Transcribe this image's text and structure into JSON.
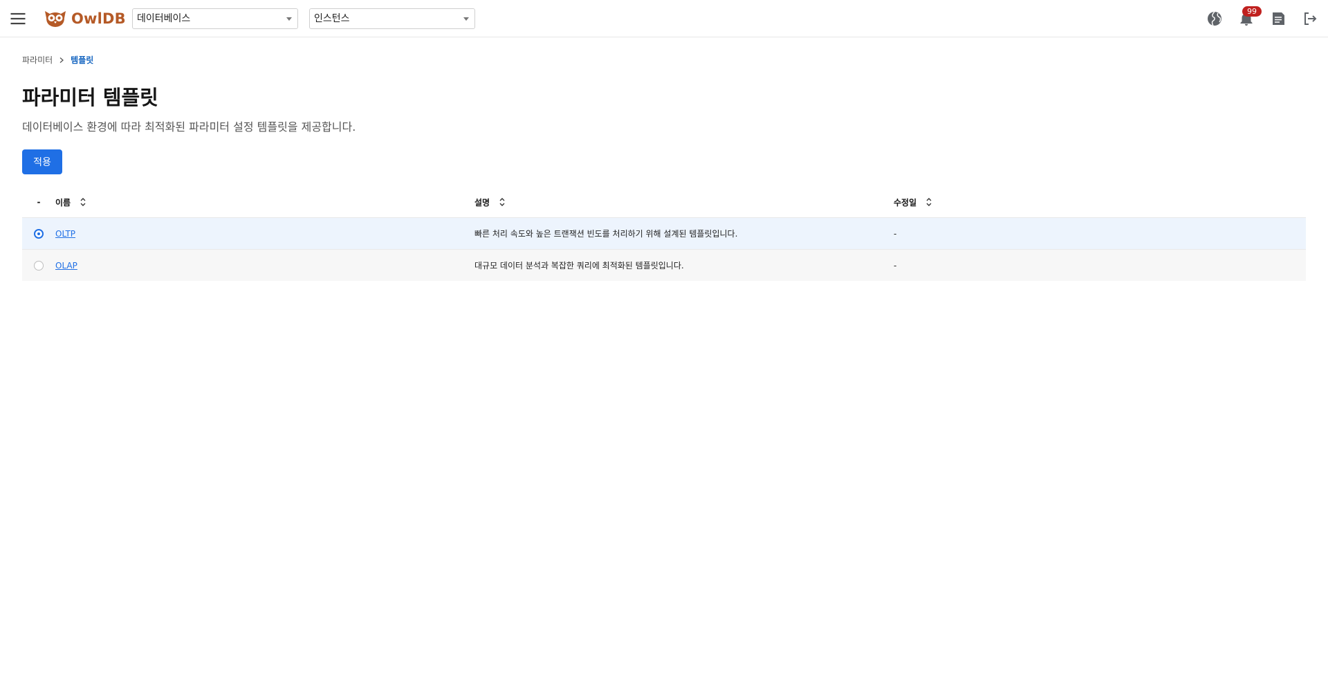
{
  "header": {
    "app_name": "OwlDB",
    "database_select": {
      "value": "데이터베이스"
    },
    "instance_select": {
      "value": "인스턴스"
    },
    "notification_count": "99",
    "icons": [
      "menu-icon",
      "globe-icon",
      "bell-icon",
      "document-icon",
      "logout-icon"
    ]
  },
  "breadcrumb": {
    "items": [
      "파라미터",
      "템플릿"
    ]
  },
  "page": {
    "title": "파라미터 템플릿",
    "description": "데이터베이스 환경에 따라 최적화된 파라미터 설정 템플릿을 제공합니다.",
    "apply_label": "적용"
  },
  "table": {
    "columns": [
      "-",
      "이름",
      "설명",
      "수정일"
    ],
    "rows": [
      {
        "selected": true,
        "name": "OLTP",
        "description": "빠른 처리 속도와 높은 트랜잭션 빈도를 처리하기 위해 설계된 템플릿입니다.",
        "modified": "-"
      },
      {
        "selected": false,
        "name": "OLAP",
        "description": "대규모 데이터 분석과 복잡한 쿼리에 최적화된 템플릿입니다.",
        "modified": "-"
      }
    ]
  },
  "colors": {
    "brand": "#b55a27",
    "primary": "#1f6fe5",
    "badge": "#c0211f",
    "selected_row": "#edf4fd"
  }
}
